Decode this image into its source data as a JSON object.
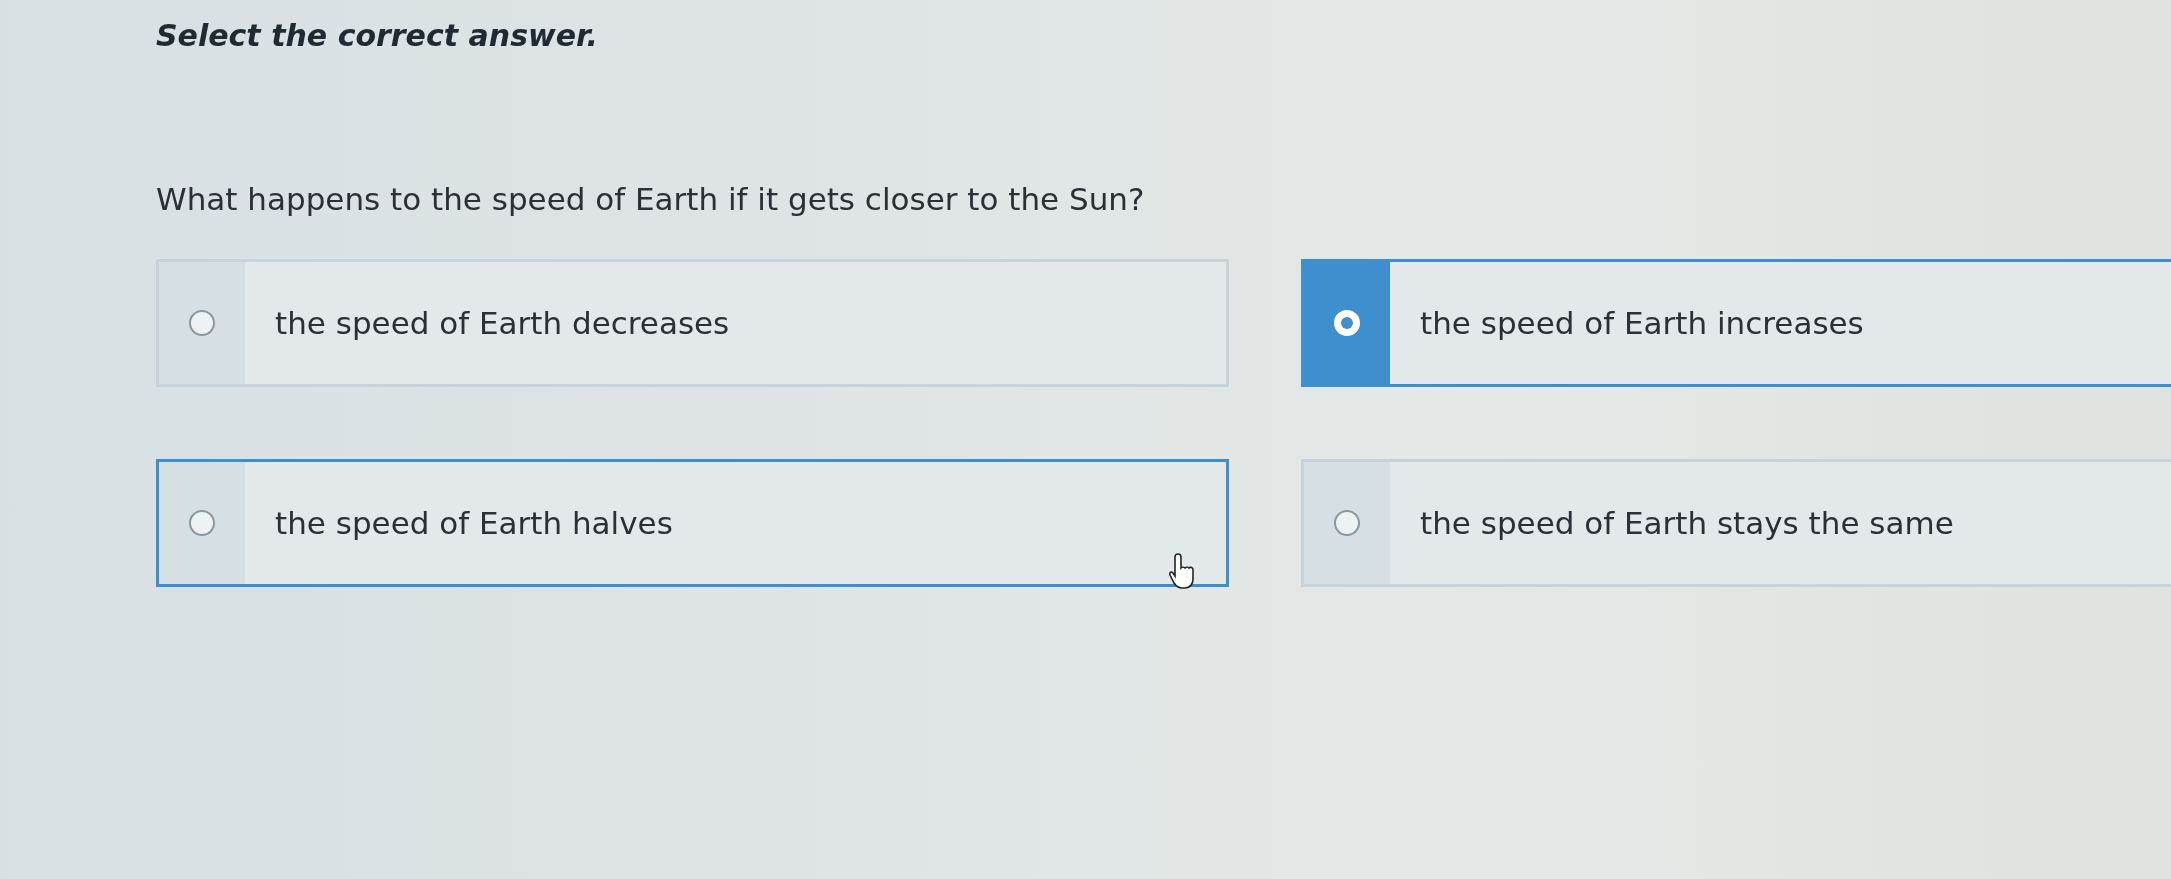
{
  "instruction": "Select the correct answer.",
  "question": "What happens to the speed of Earth if it gets closer to the Sun?",
  "options": [
    {
      "label": "the speed of Earth decreases",
      "selected": false,
      "hovered": false
    },
    {
      "label": "the speed of Earth increases",
      "selected": true,
      "hovered": false
    },
    {
      "label": "the speed of Earth halves",
      "selected": false,
      "hovered": true
    },
    {
      "label": "the speed of Earth stays the same",
      "selected": false,
      "hovered": false
    }
  ]
}
